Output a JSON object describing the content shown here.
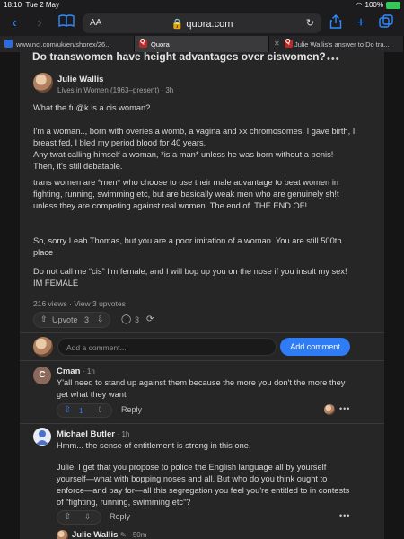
{
  "status": {
    "time": "18:10",
    "date": "Tue 2 May",
    "battery": "100%"
  },
  "browser": {
    "text_size_label": "AA",
    "url": "quora.com",
    "tabs": [
      {
        "label": "www.ncl.com/uk/en/shorex/26...",
        "active": false
      },
      {
        "label": "Quora",
        "active": true
      },
      {
        "label": "Julie Wallis's answer to Do tra...",
        "active": false
      }
    ]
  },
  "question": {
    "title": "Do transwomen have height advantages over ciswomen?"
  },
  "answer": {
    "author": "Julie Wallis",
    "credential": "Lives in Women (1963–present) · 3h",
    "paragraphs": [
      "What the fu@k is a cis woman?",
      "I'm a woman.., born with overies a womb, a vagina and xx chromosomes. I gave birth, I breast fed, I bled my period blood for 40 years.",
      "Any twat calling himself a woman, *is a man* unless he was born without a penis! Then, it's still debatable.",
      "trans women are *men* who choose to use their male advantage to beat women in fighting, running, swimming etc, but are basically weak men who are genuinely sh!t unless they are competing against real women. The end of. THE END OF!",
      "So, sorry Leah Thomas, but you are a poor imitation of a woman. You are still 500th place",
      "Do not call me “cis” I'm female, and I will bop up you on the nose if you insult my sex! IM FEMALE"
    ],
    "stats": "216 views · View 3 upvotes",
    "upvote_label": "Upvote",
    "upvote_count": "3",
    "comment_count": "3"
  },
  "composer": {
    "placeholder": "Add a comment...",
    "button": "Add comment"
  },
  "comments": [
    {
      "initial": "C",
      "author": "Cman",
      "time": "· 1h",
      "text": "Y'all need to stand up against them because the more you don't the more they get what they want",
      "upvotes": "1",
      "reply": "Reply"
    },
    {
      "author": "Michael Butler",
      "time": "· 1h",
      "text1": "Hmm... the sense of entitlement is strong in this one.",
      "text2": "Julie, I get that you propose to police the English language all by yourself yourself—what with bopping noses and all. But who do you think ought to enforce—and pay for—all this segregation you feel you're entitled to in contests of “fighting, running, swimming etc”?",
      "reply": "Reply"
    },
    {
      "author": "Julie Wallis",
      "time": "· 50m"
    }
  ],
  "colors": {
    "accent": "#2e7cf6",
    "background": "#262626",
    "upvote_active": "#2e7cf6"
  }
}
